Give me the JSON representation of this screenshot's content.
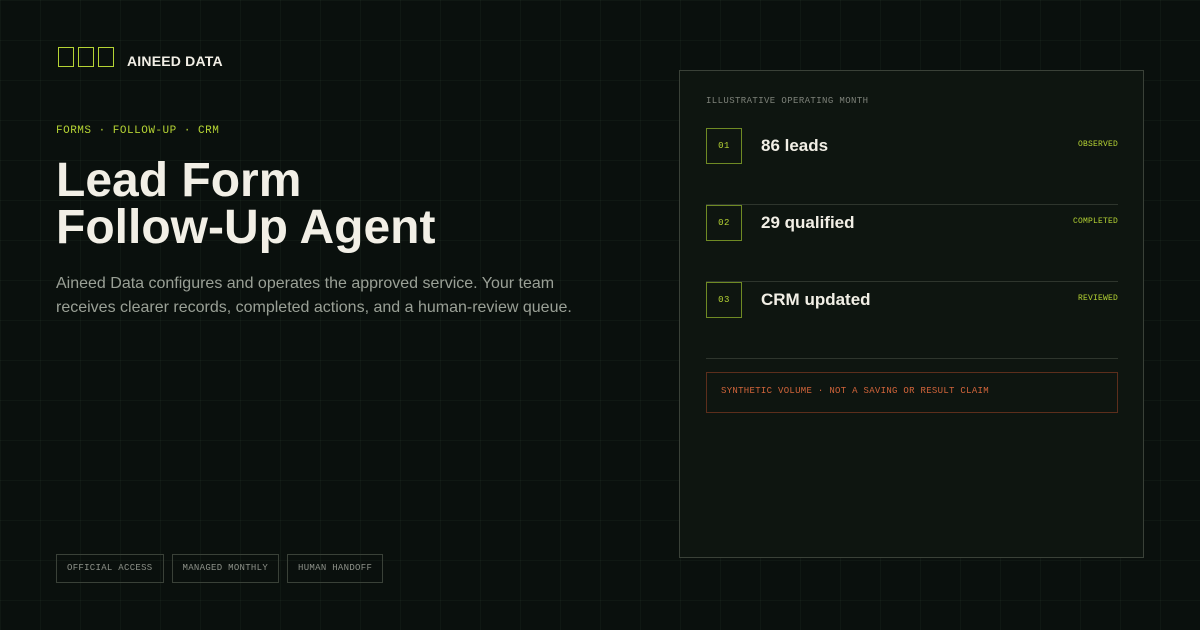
{
  "brand": {
    "name": "AINEED DATA",
    "accent_color": "#b5d334"
  },
  "hero": {
    "eyebrow": "FORMS · FOLLOW-UP · CRM",
    "title_line1": "Lead Form",
    "title_line2": "Follow-Up Agent",
    "description": "Aineed Data configures and operates the approved service. Your team receives clearer records, completed actions, and a human-review queue."
  },
  "tags": [
    "OFFICIAL ACCESS",
    "MANAGED MONTHLY",
    "HUMAN HANDOFF"
  ],
  "panel": {
    "label": "ILLUSTRATIVE OPERATING MONTH",
    "rows": [
      {
        "num": "01",
        "label": "86 leads",
        "status": "OBSERVED"
      },
      {
        "num": "02",
        "label": "29 qualified",
        "status": "COMPLETED"
      },
      {
        "num": "03",
        "label": "CRM updated",
        "status": "REVIEWED"
      }
    ],
    "disclaimer": "SYNTHETIC VOLUME · NOT A SAVING OR RESULT CLAIM",
    "disclaimer_color": "#d1643a"
  }
}
